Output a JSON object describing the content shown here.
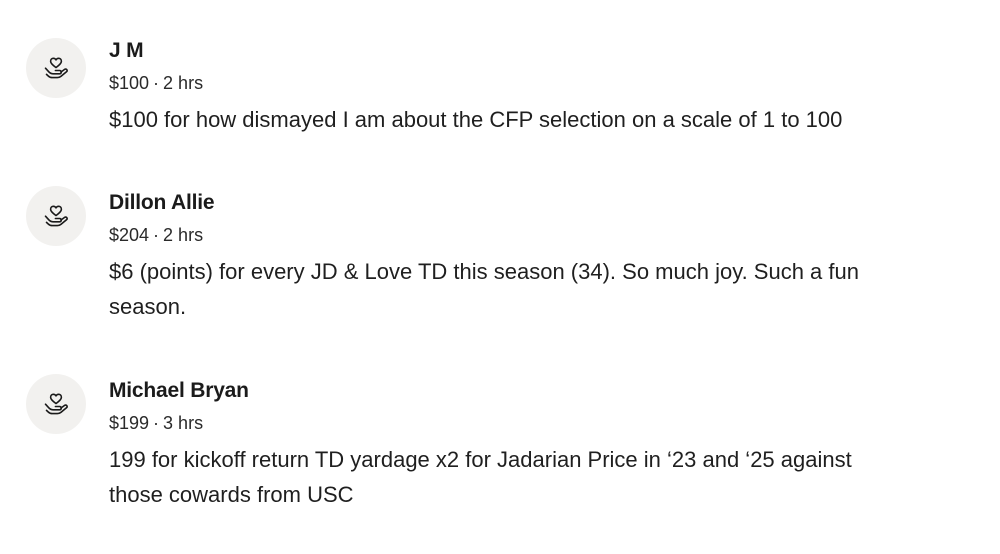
{
  "donations": [
    {
      "name": "J M",
      "amount": "$100",
      "separator": "·",
      "time": "2 hrs",
      "message": "$100 for how dismayed I am about the CFP selection on a scale of 1 to 100",
      "icon": "heart-in-hand-icon"
    },
    {
      "name": "Dillon Allie",
      "amount": "$204",
      "separator": "·",
      "time": "2 hrs",
      "message": "$6 (points) for every JD & Love TD this season (34). So much joy. Such a fun season.",
      "icon": "heart-in-hand-icon"
    },
    {
      "name": "Michael Bryan",
      "amount": "$199",
      "separator": "·",
      "time": "3 hrs",
      "message": "199 for kickoff return TD yardage x2 for Jadarian Price in ‘23 and ‘25 against those cowards from USC",
      "icon": "heart-in-hand-icon"
    }
  ]
}
